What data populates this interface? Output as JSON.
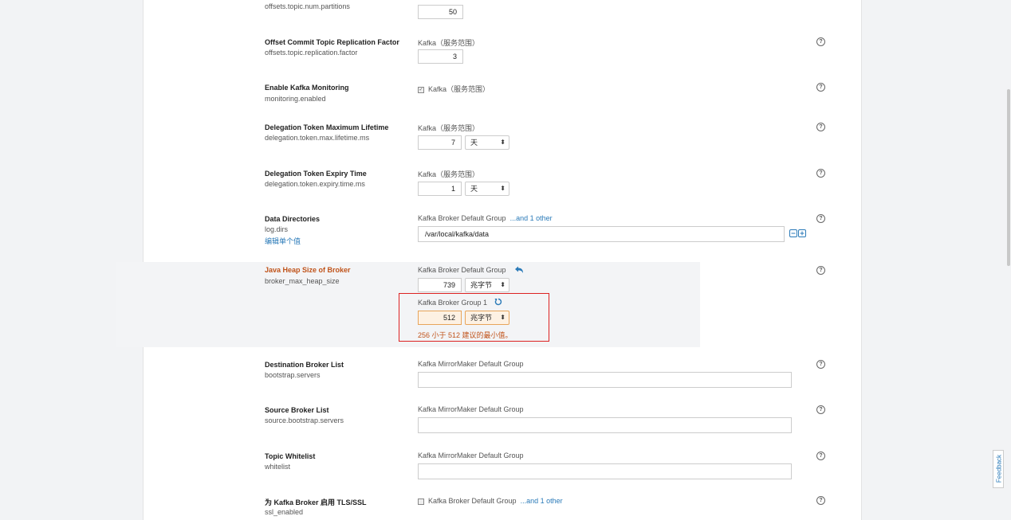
{
  "rows": {
    "partitions": {
      "key": "offsets.topic.num.partitions",
      "value": "50"
    },
    "replication": {
      "name": "Offset Commit Topic Replication Factor",
      "key": "offsets.topic.replication.factor",
      "scope": "Kafka（服务范围）",
      "value": "3"
    },
    "monitoring": {
      "name": "Enable Kafka Monitoring",
      "key": "monitoring.enabled",
      "scope": "Kafka（服务范围）",
      "checked": true
    },
    "token_max": {
      "name": "Delegation Token Maximum Lifetime",
      "key": "delegation.token.max.lifetime.ms",
      "scope": "Kafka（服务范围）",
      "value": "7",
      "unit": "天"
    },
    "token_expiry": {
      "name": "Delegation Token Expiry Time",
      "key": "delegation.token.expiry.time.ms",
      "scope": "Kafka（服务范围）",
      "value": "1",
      "unit": "天"
    },
    "data_dirs": {
      "name": "Data Directories",
      "key": "log.dirs",
      "edit_link": "编辑单个值",
      "scope": "Kafka Broker Default Group",
      "others_link": "...and 1 other",
      "value": "/var/local/kafka/data"
    },
    "heap": {
      "name": "Java Heap Size of Broker",
      "key": "broker_max_heap_size",
      "scope": "Kafka Broker Default Group",
      "value": "739",
      "unit": "兆字节",
      "group1_scope": "Kafka Broker Group 1",
      "group1_value": "512",
      "group1_unit": "兆字节",
      "warning": "256 小于 512 建议的最小值。"
    },
    "dest_brokers": {
      "name": "Destination Broker List",
      "key": "bootstrap.servers",
      "scope": "Kafka MirrorMaker Default Group",
      "value": ""
    },
    "src_brokers": {
      "name": "Source Broker List",
      "key": "source.bootstrap.servers",
      "scope": "Kafka MirrorMaker Default Group",
      "value": ""
    },
    "whitelist": {
      "name": "Topic Whitelist",
      "key": "whitelist",
      "scope": "Kafka MirrorMaker Default Group",
      "value": ""
    },
    "ssl": {
      "name": "为 Kafka Broker 启用 TLS/SSL",
      "key": "ssl_enabled",
      "scope": "Kafka Broker Default Group",
      "others_link": "...and 1 other",
      "checked": false
    }
  },
  "help_glyph": "?",
  "feedback_label": "Feedback",
  "colors": {
    "heap_name": "#c0531a",
    "link": "#2a7ab8",
    "error": "#dd2222",
    "warning_text": "#c0531a"
  }
}
